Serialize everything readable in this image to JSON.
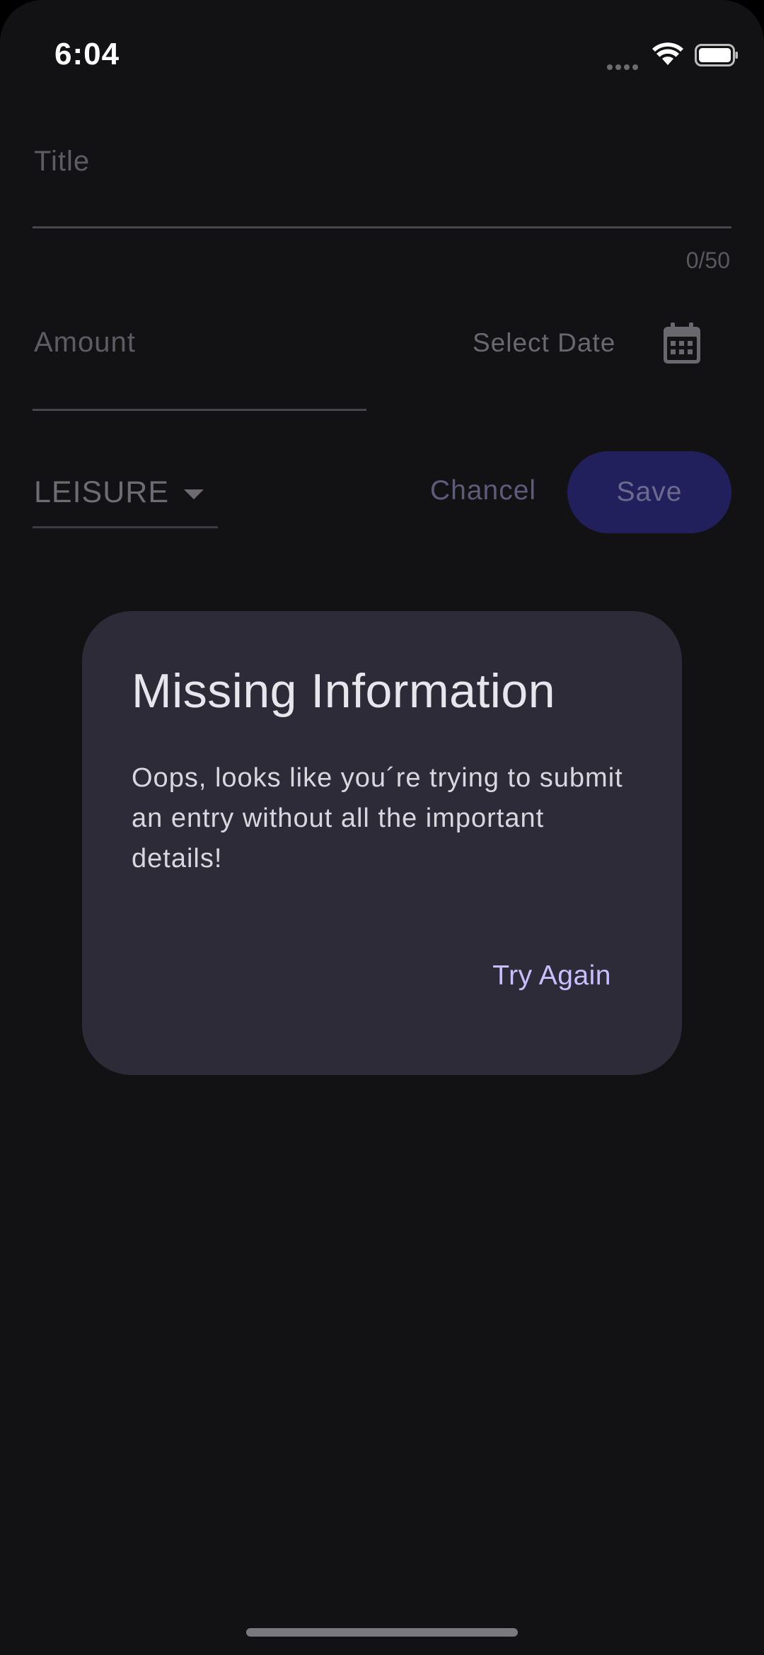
{
  "status_bar": {
    "time": "6:04"
  },
  "form": {
    "title_label": "Title",
    "title_counter": "0/50",
    "amount_label": "Amount",
    "select_date_label": "Select Date",
    "category_value": "LEISURE",
    "cancel_label": "Chancel",
    "save_label": "Save"
  },
  "dialog": {
    "title": "Missing Information",
    "body": "Oops, looks like you´re trying to submit an entry without all the important details!",
    "action_label": "Try Again"
  },
  "colors": {
    "background": "#121214",
    "dialog_surface": "#2d2b37",
    "accent": "#c9bfff",
    "save_button": "#22205c"
  },
  "icons": {
    "wifi": "wifi-icon",
    "battery": "battery-icon",
    "calendar": "calendar-icon",
    "dropdown": "dropdown-arrow-icon"
  }
}
